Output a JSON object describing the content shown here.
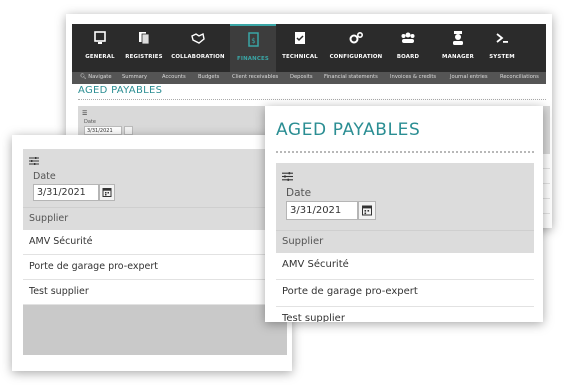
{
  "nav": {
    "items": [
      {
        "label": "GENERAL",
        "icon": "monitor-icon"
      },
      {
        "label": "REGISTRIES",
        "icon": "documents-icon"
      },
      {
        "label": "COLLABORATION",
        "icon": "handshake-icon"
      },
      {
        "label": "FINANCES",
        "icon": "finance-document-icon"
      },
      {
        "label": "TECHNICAL",
        "icon": "clipboard-check-icon"
      },
      {
        "label": "CONFIGURATION",
        "icon": "gears-icon"
      },
      {
        "label": "BOARD",
        "icon": "group-icon"
      },
      {
        "label": "MANAGER",
        "icon": "manager-icon"
      },
      {
        "label": "SYSTEM",
        "icon": "terminal-icon"
      }
    ],
    "active_index": 3,
    "accent_color": "#3aa6a6"
  },
  "subnav": {
    "items": [
      "Navigate",
      "Summary",
      "Accounts",
      "Budgets",
      "Client receivables",
      "Deposits",
      "Financial statements",
      "Invoices & credits",
      "Journal entries",
      "Reconciliations"
    ]
  },
  "page": {
    "title": "AGED PAYABLES",
    "title_color": "#2b8e93"
  },
  "filter": {
    "date_label": "Date",
    "date_value": "3/31/2021"
  },
  "table": {
    "header": "Supplier",
    "rows": [
      "AMV Sécurité",
      "Porte de garage pro-expert",
      "Test supplier"
    ]
  }
}
